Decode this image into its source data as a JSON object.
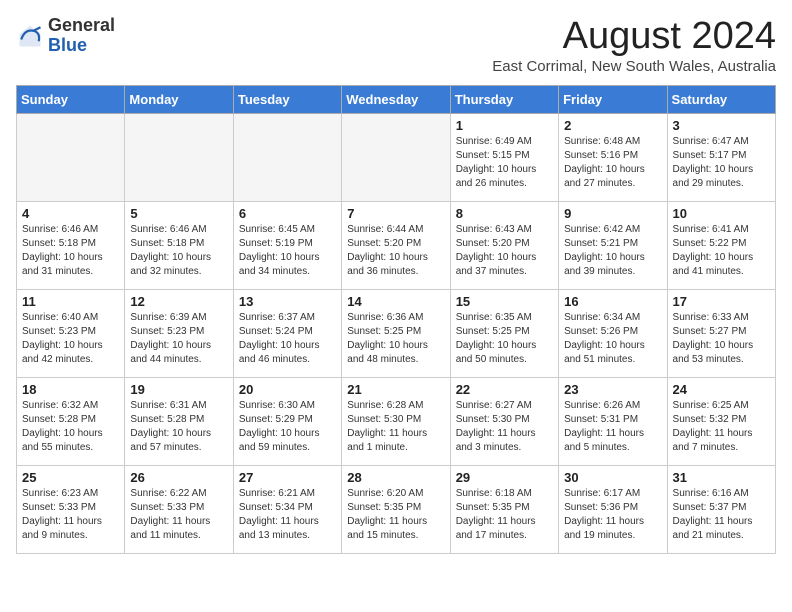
{
  "header": {
    "logo_general": "General",
    "logo_blue": "Blue",
    "month_title": "August 2024",
    "location": "East Corrimal, New South Wales, Australia"
  },
  "days_of_week": [
    "Sunday",
    "Monday",
    "Tuesday",
    "Wednesday",
    "Thursday",
    "Friday",
    "Saturday"
  ],
  "weeks": [
    [
      {
        "day": "",
        "sunrise": "",
        "sunset": "",
        "daylight": ""
      },
      {
        "day": "",
        "sunrise": "",
        "sunset": "",
        "daylight": ""
      },
      {
        "day": "",
        "sunrise": "",
        "sunset": "",
        "daylight": ""
      },
      {
        "day": "",
        "sunrise": "",
        "sunset": "",
        "daylight": ""
      },
      {
        "day": "1",
        "sunrise": "Sunrise: 6:49 AM",
        "sunset": "Sunset: 5:15 PM",
        "daylight": "Daylight: 10 hours and 26 minutes."
      },
      {
        "day": "2",
        "sunrise": "Sunrise: 6:48 AM",
        "sunset": "Sunset: 5:16 PM",
        "daylight": "Daylight: 10 hours and 27 minutes."
      },
      {
        "day": "3",
        "sunrise": "Sunrise: 6:47 AM",
        "sunset": "Sunset: 5:17 PM",
        "daylight": "Daylight: 10 hours and 29 minutes."
      }
    ],
    [
      {
        "day": "4",
        "sunrise": "Sunrise: 6:46 AM",
        "sunset": "Sunset: 5:18 PM",
        "daylight": "Daylight: 10 hours and 31 minutes."
      },
      {
        "day": "5",
        "sunrise": "Sunrise: 6:46 AM",
        "sunset": "Sunset: 5:18 PM",
        "daylight": "Daylight: 10 hours and 32 minutes."
      },
      {
        "day": "6",
        "sunrise": "Sunrise: 6:45 AM",
        "sunset": "Sunset: 5:19 PM",
        "daylight": "Daylight: 10 hours and 34 minutes."
      },
      {
        "day": "7",
        "sunrise": "Sunrise: 6:44 AM",
        "sunset": "Sunset: 5:20 PM",
        "daylight": "Daylight: 10 hours and 36 minutes."
      },
      {
        "day": "8",
        "sunrise": "Sunrise: 6:43 AM",
        "sunset": "Sunset: 5:20 PM",
        "daylight": "Daylight: 10 hours and 37 minutes."
      },
      {
        "day": "9",
        "sunrise": "Sunrise: 6:42 AM",
        "sunset": "Sunset: 5:21 PM",
        "daylight": "Daylight: 10 hours and 39 minutes."
      },
      {
        "day": "10",
        "sunrise": "Sunrise: 6:41 AM",
        "sunset": "Sunset: 5:22 PM",
        "daylight": "Daylight: 10 hours and 41 minutes."
      }
    ],
    [
      {
        "day": "11",
        "sunrise": "Sunrise: 6:40 AM",
        "sunset": "Sunset: 5:23 PM",
        "daylight": "Daylight: 10 hours and 42 minutes."
      },
      {
        "day": "12",
        "sunrise": "Sunrise: 6:39 AM",
        "sunset": "Sunset: 5:23 PM",
        "daylight": "Daylight: 10 hours and 44 minutes."
      },
      {
        "day": "13",
        "sunrise": "Sunrise: 6:37 AM",
        "sunset": "Sunset: 5:24 PM",
        "daylight": "Daylight: 10 hours and 46 minutes."
      },
      {
        "day": "14",
        "sunrise": "Sunrise: 6:36 AM",
        "sunset": "Sunset: 5:25 PM",
        "daylight": "Daylight: 10 hours and 48 minutes."
      },
      {
        "day": "15",
        "sunrise": "Sunrise: 6:35 AM",
        "sunset": "Sunset: 5:25 PM",
        "daylight": "Daylight: 10 hours and 50 minutes."
      },
      {
        "day": "16",
        "sunrise": "Sunrise: 6:34 AM",
        "sunset": "Sunset: 5:26 PM",
        "daylight": "Daylight: 10 hours and 51 minutes."
      },
      {
        "day": "17",
        "sunrise": "Sunrise: 6:33 AM",
        "sunset": "Sunset: 5:27 PM",
        "daylight": "Daylight: 10 hours and 53 minutes."
      }
    ],
    [
      {
        "day": "18",
        "sunrise": "Sunrise: 6:32 AM",
        "sunset": "Sunset: 5:28 PM",
        "daylight": "Daylight: 10 hours and 55 minutes."
      },
      {
        "day": "19",
        "sunrise": "Sunrise: 6:31 AM",
        "sunset": "Sunset: 5:28 PM",
        "daylight": "Daylight: 10 hours and 57 minutes."
      },
      {
        "day": "20",
        "sunrise": "Sunrise: 6:30 AM",
        "sunset": "Sunset: 5:29 PM",
        "daylight": "Daylight: 10 hours and 59 minutes."
      },
      {
        "day": "21",
        "sunrise": "Sunrise: 6:28 AM",
        "sunset": "Sunset: 5:30 PM",
        "daylight": "Daylight: 11 hours and 1 minute."
      },
      {
        "day": "22",
        "sunrise": "Sunrise: 6:27 AM",
        "sunset": "Sunset: 5:30 PM",
        "daylight": "Daylight: 11 hours and 3 minutes."
      },
      {
        "day": "23",
        "sunrise": "Sunrise: 6:26 AM",
        "sunset": "Sunset: 5:31 PM",
        "daylight": "Daylight: 11 hours and 5 minutes."
      },
      {
        "day": "24",
        "sunrise": "Sunrise: 6:25 AM",
        "sunset": "Sunset: 5:32 PM",
        "daylight": "Daylight: 11 hours and 7 minutes."
      }
    ],
    [
      {
        "day": "25",
        "sunrise": "Sunrise: 6:23 AM",
        "sunset": "Sunset: 5:33 PM",
        "daylight": "Daylight: 11 hours and 9 minutes."
      },
      {
        "day": "26",
        "sunrise": "Sunrise: 6:22 AM",
        "sunset": "Sunset: 5:33 PM",
        "daylight": "Daylight: 11 hours and 11 minutes."
      },
      {
        "day": "27",
        "sunrise": "Sunrise: 6:21 AM",
        "sunset": "Sunset: 5:34 PM",
        "daylight": "Daylight: 11 hours and 13 minutes."
      },
      {
        "day": "28",
        "sunrise": "Sunrise: 6:20 AM",
        "sunset": "Sunset: 5:35 PM",
        "daylight": "Daylight: 11 hours and 15 minutes."
      },
      {
        "day": "29",
        "sunrise": "Sunrise: 6:18 AM",
        "sunset": "Sunset: 5:35 PM",
        "daylight": "Daylight: 11 hours and 17 minutes."
      },
      {
        "day": "30",
        "sunrise": "Sunrise: 6:17 AM",
        "sunset": "Sunset: 5:36 PM",
        "daylight": "Daylight: 11 hours and 19 minutes."
      },
      {
        "day": "31",
        "sunrise": "Sunrise: 6:16 AM",
        "sunset": "Sunset: 5:37 PM",
        "daylight": "Daylight: 11 hours and 21 minutes."
      }
    ]
  ]
}
